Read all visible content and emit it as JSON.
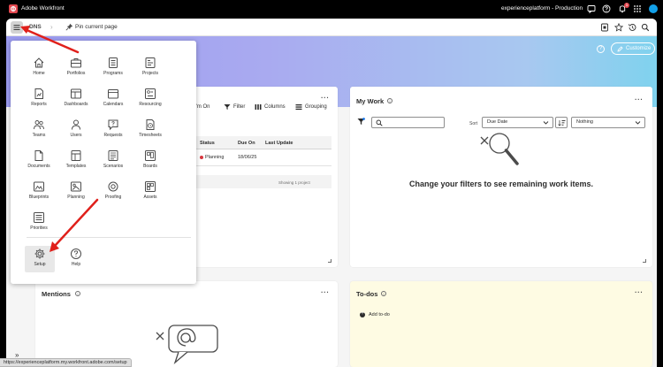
{
  "app": {
    "title": "Adobe Workfront",
    "environment": "experienceplatform - Production",
    "notification_count": "1",
    "brand_color": "#e34850"
  },
  "subbar": {
    "breadcrumb": "DNS",
    "pin_label": "Pin current page"
  },
  "hero": {
    "customize_label": "Customize",
    "help_symbol": "?"
  },
  "projects_card": {
    "toolbar": {
      "assigned_label": "I'm On",
      "filter_label": "Filter",
      "columns_label": "Columns",
      "grouping_label": "Grouping"
    },
    "columns": [
      "Status",
      "Due On",
      "Last Update"
    ],
    "rows": [
      {
        "status": "Planning",
        "due_on": "18/06/25",
        "last_update": ""
      }
    ],
    "status_color": "#d7373f",
    "footer": "Showing 1 project"
  },
  "my_work": {
    "title": "My Work",
    "search_placeholder": "",
    "sort_label": "Sort",
    "sort_value": "Due Date",
    "group_value": "Nothing",
    "empty_message": "Change your filters to see remaining work items."
  },
  "mentions": {
    "title": "Mentions"
  },
  "todos": {
    "title": "To-dos",
    "add_label": "Add to-do"
  },
  "main_menu": {
    "items": [
      {
        "label": "Home",
        "icon": "home-icon"
      },
      {
        "label": "Portfolios",
        "icon": "portfolio-icon"
      },
      {
        "label": "Programs",
        "icon": "programs-icon"
      },
      {
        "label": "Projects",
        "icon": "projects-icon"
      },
      {
        "label": "Reports",
        "icon": "reports-icon"
      },
      {
        "label": "Dashboards",
        "icon": "dashboards-icon"
      },
      {
        "label": "Calendars",
        "icon": "calendar-icon"
      },
      {
        "label": "Resourcing",
        "icon": "resourcing-icon"
      },
      {
        "label": "Teams",
        "icon": "teams-icon"
      },
      {
        "label": "Users",
        "icon": "user-icon"
      },
      {
        "label": "Requests",
        "icon": "requests-icon"
      },
      {
        "label": "Timesheets",
        "icon": "timesheets-icon"
      },
      {
        "label": "Documents",
        "icon": "documents-icon"
      },
      {
        "label": "Templates",
        "icon": "templates-icon"
      },
      {
        "label": "Scenarios",
        "icon": "scenarios-icon"
      },
      {
        "label": "Boards",
        "icon": "boards-icon"
      },
      {
        "label": "Blueprints",
        "icon": "blueprints-icon"
      },
      {
        "label": "Planning",
        "icon": "planning-icon"
      },
      {
        "label": "Proofing",
        "icon": "proofing-icon"
      },
      {
        "label": "Assets",
        "icon": "assets-icon"
      },
      {
        "label": "Priorities",
        "icon": "priorities-icon"
      }
    ],
    "bottom_items": [
      {
        "label": "Setup",
        "icon": "gear-icon"
      },
      {
        "label": "Help",
        "icon": "help-icon"
      }
    ]
  },
  "status_bar": {
    "url": "https://experienceplatform.my.workfront.adobe.com/setup"
  },
  "annotation_color": "#e0201b"
}
